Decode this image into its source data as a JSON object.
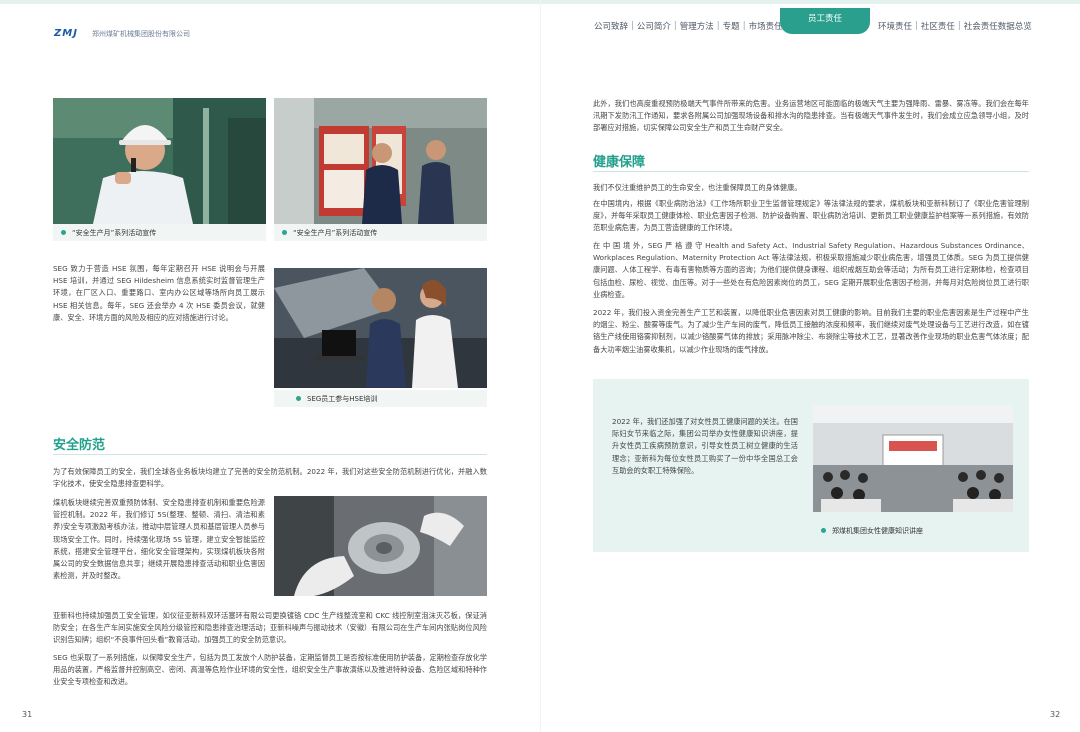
{
  "header": {
    "logo": "ZMJ",
    "company": "郑州煤矿机械集团股份有限公司",
    "nav_left": [
      "公司致辞",
      "公司简介",
      "管理方法",
      "专题",
      "市场责任"
    ],
    "nav_active": "员工责任",
    "nav_right": [
      "环境责任",
      "社区责任",
      "社会责任数据总览"
    ]
  },
  "left": {
    "captions": {
      "c1": "“安全生产月”系列活动宣传",
      "c2": "“安全生产月”系列活动宣传",
      "c3": "SEG员工参与HSE培训"
    },
    "hse_para": "SEG 致力于营造 HSE 氛围，每年定期召开 HSE 说明会与开展 HSE 培训，并通过 SEG Hildesheim 信息系统实时监督管理生产环境，在厂区入口、重要路口、室内办公区域等场所向员工展示 HSE 相关信息。每年，SEG 还会举办 4 次 HSE 委员会议，就健康、安全、环境方面的风险及相应的应对措施进行讨论。",
    "safety_heading": "安全防范",
    "safety_p1": "为了有效保障员工的安全，我们全球各业务板块均建立了完善的安全防范机制。2022 年，我们对这些安全防范机制进行优化，并融入数字化技术，使安全隐患排查更科学。",
    "safety_p2": "煤机板块继续完善双重预防体制、安全隐患排查机制和重要危险源管控机制。2022 年，我们修订 5S(整理、整顿、清扫、清洁和素养)安全专项激励考核办法，推动中层管理人员和基层管理人员参与现场安全工作。同时，持续强化现场 5S 管理，建立安全智能监控系统，搭建安全管理平台，细化安全管理架构，实现煤机板块各附属公司的安全数据信息共享；继续开展隐患排查活动和职业危害因素检测，并及时整改。",
    "safety_p3": "亚新科也持续加强员工安全管理，如仪征亚新科双环活塞环有限公司更换镀铬 CDC 生产线整流室和 CKC 线控制室泡沫灭芯板，保证消防安全；在各生产车间实施安全风险分级管控和隐患排查治理活动；亚新科噪声与振动技术（安徽）有限公司在生产车间内张贴岗位风险识别告知牌；组织“不良事件回头看”教育活动，加强员工的安全防范意识。",
    "safety_p4": "SEG 也采取了一系列措施，以保障安全生产，包括为员工发放个人防护装备，定期监督员工是否按标准使用防护装备，定期检查存放化学用品的装置，严格监督并控制高空、密闭、高温等危险作业环境的安全性，组织安全生产事故演练以及推进特种设备、危险区域和特种作业安全专项检查和改进。",
    "page_number": "31"
  },
  "right": {
    "weather_para": "此外，我们也高度重视预防极端天气事件所带来的危害。业务运营地区可能面临的极端天气主要为强降雨、雷暴、雾冻等。我们会在每年汛期下发防汛工作通知，要求各附属公司加强现场设备和排水沟的隐患排查。当有极端天气事件发生时，我们会成立应急领导小组，及时部署应对措施，切实保障公司安全生产和员工生命财产安全。",
    "health_heading": "健康保障",
    "health_p1": "我们不仅注重维护员工的生命安全，也注重保障员工的身体健康。",
    "health_p2": "在中国境内，根据《职业病防治法》《工作场所职业卫生监督管理规定》等法律法规的要求，煤机板块和亚新科制订了《职业危害管理制度》，并每年采取员工健康体检、职业危害因子检测、防护设备购置、职业病防治培训、更新员工职业健康监护档案等一系列措施，有效防范职业病危害，为员工营造健康的工作环境。",
    "health_p3": "在 中 国 境 外，SEG 严 格 遵 守 Health and Safety Act、Industrial Safety Regulation、Hazardous Substances Ordinance、Workplaces Regulation、Maternity Protection Act 等法律法规，积极采取措施减少职业病危害，增强员工体质。SEG 为员工提供健康问题、人体工程学、有毒有害物质等方面的咨询；为他们提供健身课程、组织戒烟互助会等活动；为所有员工进行定期体检，检查项目包括血检、尿检、视觉、血压等。对于一些处在有危险因素岗位的员工，SEG 定期开展职业危害因子检测，并每月对危险岗位员工进行职业病检查。",
    "health_p4": "2022 年，我们投入资金完善生产工艺和装置，以降低职业危害因素对员工健康的影响。目前我们主要的职业危害因素是生产过程中产生的烟尘、粉尘、酸雾等废气。为了减少生产车间的废气，降低员工接触的浓度和频率，我们继续对废气处理设备与工艺进行改造，如在镀铬生产线使用铬雾抑制剂，以减少铬酸雾气体的排放；采用脉冲除尘、布袋除尘等技术工艺，显著改善作业现场的职业危害气体浓度；配备大功率烟尘油雾收集机，以减少作业现场的废气排放。",
    "box_para": "2022 年，我们还加强了对女性员工健康问题的关注。在国际妇女节来临之际，集团公司举办女性健康知识讲座，提升女性员工疾病预防意识，引导女性员工树立健康的生活理念；亚新科为每位女性员工购买了一份中华全国总工会互助会的女职工特殊保险。",
    "box_caption": "郑煤机集团女性健康知识讲座",
    "page_number": "32"
  },
  "colors": {
    "accent": "#2a9f8d",
    "heading": "#22a08c",
    "box_bg": "#e6f3f1"
  }
}
